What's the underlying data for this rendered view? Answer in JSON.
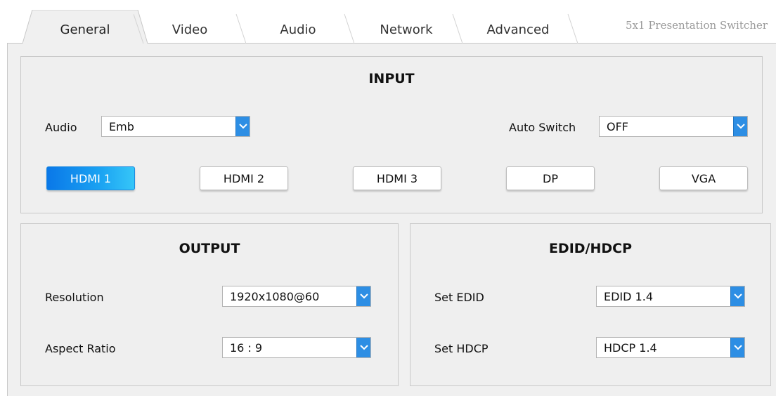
{
  "tabs": [
    {
      "label": "General",
      "active": true
    },
    {
      "label": "Video",
      "active": false
    },
    {
      "label": "Audio",
      "active": false
    },
    {
      "label": "Network",
      "active": false
    },
    {
      "label": "Advanced",
      "active": false
    }
  ],
  "product_name": "5x1 Presentation Switcher",
  "input": {
    "title": "INPUT",
    "audio_label": "Audio",
    "audio_value": "Emb",
    "auto_switch_label": "Auto Switch",
    "auto_switch_value": "OFF",
    "sources": [
      {
        "label": "HDMI 1",
        "active": true
      },
      {
        "label": "HDMI 2",
        "active": false
      },
      {
        "label": "HDMI 3",
        "active": false
      },
      {
        "label": "DP",
        "active": false
      },
      {
        "label": "VGA",
        "active": false
      }
    ]
  },
  "output": {
    "title": "OUTPUT",
    "resolution_label": "Resolution",
    "resolution_value": "1920x1080@60",
    "aspect_label": "Aspect Ratio",
    "aspect_value": "16 : 9"
  },
  "edid_hdcp": {
    "title": "EDID/HDCP",
    "edid_label": "Set EDID",
    "edid_value": "EDID 1.4",
    "hdcp_label": "Set HDCP",
    "hdcp_value": "HDCP 1.4"
  },
  "colors": {
    "accent": "#2d8ee4",
    "active_button_start": "#0a78e8",
    "active_button_end": "#36c6f8",
    "panel_bg": "#efefef"
  }
}
